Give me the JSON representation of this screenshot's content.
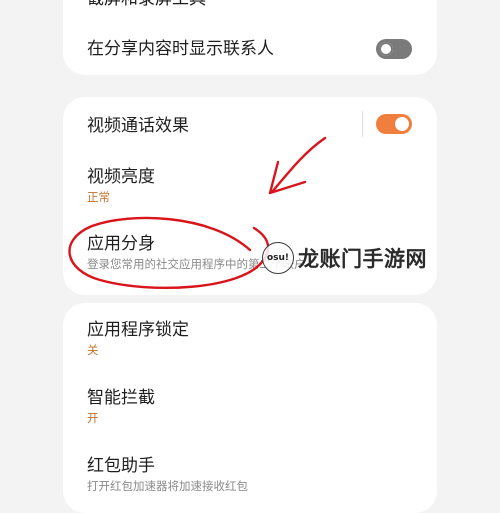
{
  "top_card": {
    "cut_row_title": "截屏和录屏工具",
    "share_row_title": "在分享内容时显示联系人",
    "share_toggle": "off"
  },
  "middle_card": {
    "video_call_effects": {
      "title": "视频通话效果",
      "toggle": "on"
    },
    "video_brightness": {
      "title": "视频亮度",
      "value": "正常"
    },
    "dual_app": {
      "title": "应用分身",
      "description": "登录您常用的社交应用程序中的第二个帐户"
    }
  },
  "bottom_card": {
    "app_lock": {
      "title": "应用程序锁定",
      "value": "关"
    },
    "smart_block": {
      "title": "智能拦截",
      "value": "开"
    },
    "red_packet": {
      "title": "红包助手",
      "description": "打开红包加速器将加速接收红包"
    }
  },
  "watermark": {
    "logo_text": "osu!",
    "site_name": "龙账门手游网"
  },
  "colors": {
    "accent": "#f07f3e",
    "annotation": "#d9141b",
    "value_orange": "#c4702a"
  }
}
